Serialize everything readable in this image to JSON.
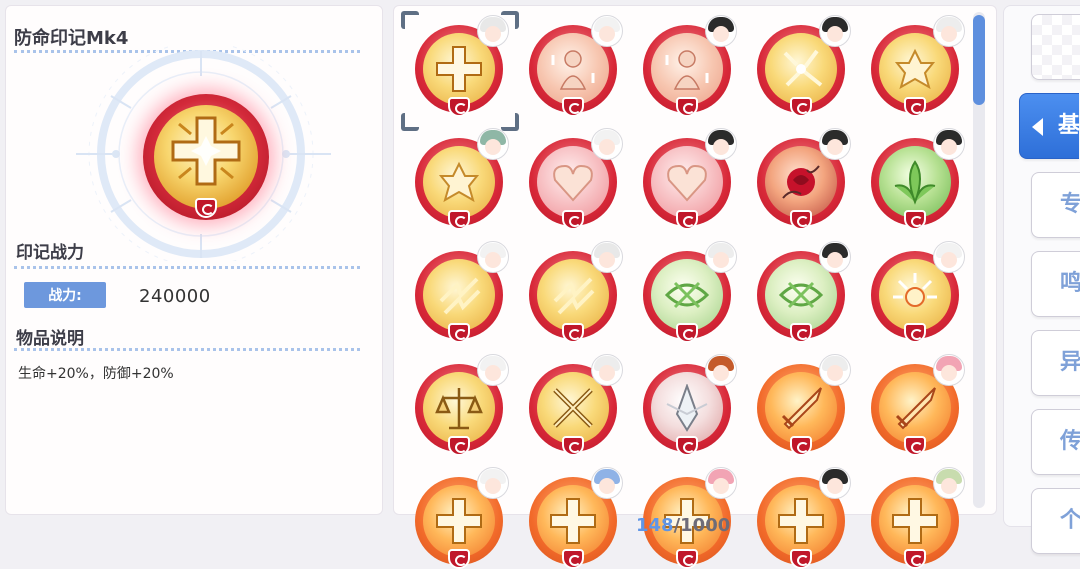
{
  "detail": {
    "item_name": "防命印记Mk4",
    "power_title": "印记战力",
    "power_label": "战力:",
    "power_value": "240000",
    "desc_title": "物品说明",
    "desc_text": "生命+20%，防御+20%",
    "icon": "cross-seal-icon"
  },
  "grid": {
    "selected_index": 0,
    "items": [
      {
        "motif": "cross",
        "face": "gold",
        "rim": "red",
        "hair": "#e8e8e8"
      },
      {
        "motif": "doll",
        "face": "peach",
        "rim": "red",
        "hair": "#f2f2f2"
      },
      {
        "motif": "doll",
        "face": "peach",
        "rim": "red",
        "hair": "#2b2b2b"
      },
      {
        "motif": "sparkle",
        "face": "gold",
        "rim": "red",
        "hair": "#2b2b2b"
      },
      {
        "motif": "bloom",
        "face": "gold",
        "rim": "red",
        "hair": "#ededed"
      },
      {
        "motif": "bloom",
        "face": "gold",
        "rim": "red",
        "hair": "#8fb7a6"
      },
      {
        "motif": "heart",
        "face": "pink",
        "rim": "red",
        "hair": "#f2f2f2"
      },
      {
        "motif": "heart",
        "face": "pink",
        "rim": "red",
        "hair": "#2b2b2b"
      },
      {
        "motif": "rose",
        "face": "ruby",
        "rim": "red",
        "hair": "#2b2b2b"
      },
      {
        "motif": "leaf",
        "face": "green",
        "rim": "red",
        "hair": "#2b2b2b"
      },
      {
        "motif": "spark",
        "face": "gold",
        "rim": "red",
        "hair": "#f2f2f2"
      },
      {
        "motif": "spark",
        "face": "gold",
        "rim": "red",
        "hair": "#e8e8e8"
      },
      {
        "motif": "thorn",
        "face": "lime",
        "rim": "red",
        "hair": "#ededed"
      },
      {
        "motif": "thorn",
        "face": "lime",
        "rim": "red",
        "hair": "#2b2b2b"
      },
      {
        "motif": "sun",
        "face": "gold",
        "rim": "red",
        "hair": "#f2f2f2"
      },
      {
        "motif": "scale",
        "face": "gold",
        "rim": "red",
        "hair": "#f2f2f2"
      },
      {
        "motif": "swords",
        "face": "gold",
        "rim": "red",
        "hair": "#ededed"
      },
      {
        "motif": "blade",
        "face": "silver",
        "rim": "red",
        "hair": "#c45a2a"
      },
      {
        "motif": "sword",
        "face": "fire",
        "rim": "orange",
        "hair": "#ededed"
      },
      {
        "motif": "sword",
        "face": "fire",
        "rim": "orange",
        "hair": "#f2a4b4"
      },
      {
        "motif": "cross",
        "face": "fire",
        "rim": "orange",
        "hair": "#f2f2f2"
      },
      {
        "motif": "cross",
        "face": "fire",
        "rim": "orange",
        "hair": "#8fb2e6"
      },
      {
        "motif": "cross",
        "face": "fire",
        "rim": "orange",
        "hair": "#f2a4b4"
      },
      {
        "motif": "cross",
        "face": "fire",
        "rim": "orange",
        "hair": "#2b2b2b"
      },
      {
        "motif": "cross",
        "face": "fire",
        "rim": "orange",
        "hair": "#c8dcae"
      }
    ]
  },
  "tabs": [
    {
      "label": "",
      "state": "blank"
    },
    {
      "label": "基",
      "state": "active"
    },
    {
      "label": "专",
      "state": "normal"
    },
    {
      "label": "鸣",
      "state": "normal"
    },
    {
      "label": "异",
      "state": "normal"
    },
    {
      "label": "传",
      "state": "normal"
    },
    {
      "label": "个",
      "state": "normal"
    }
  ],
  "pager": {
    "current": "148",
    "separator": "/",
    "total": "1000"
  },
  "colors": {
    "accent": "#3a7ee6",
    "badge": "#6d98dd",
    "rim_red": "#d82838",
    "rim_orange": "#f26a2a"
  }
}
